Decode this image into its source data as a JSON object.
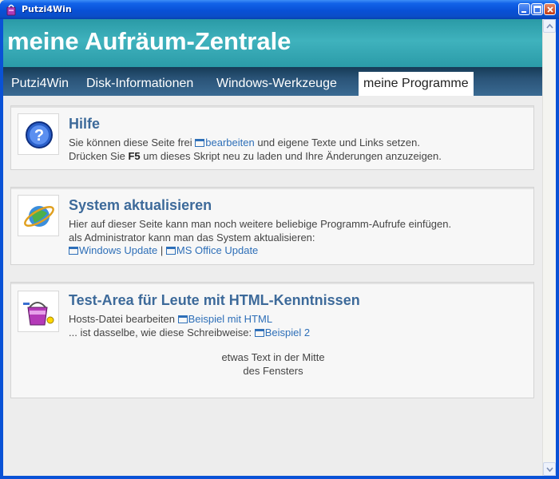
{
  "window": {
    "title": "Putzi4Win"
  },
  "header": {
    "title": "meine Aufräum-Zentrale"
  },
  "nav": {
    "tabs": [
      {
        "label": "Putzi4Win"
      },
      {
        "label": "Disk-Informationen"
      },
      {
        "label": "Windows-Werkzeuge"
      },
      {
        "label": "meine Programme"
      }
    ]
  },
  "panels": {
    "help": {
      "title": "Hilfe",
      "line1_pre": "Sie können diese Seite frei",
      "line1_link": "bearbeiten",
      "line1_post": "und eigene Texte und Links setzen.",
      "line2_pre": "Drücken Sie",
      "line2_key": "F5",
      "line2_post": "um dieses Skript neu zu laden und Ihre Änderungen anzuzeigen."
    },
    "update": {
      "title": "System aktualisieren",
      "line1": "Hier auf dieser Seite kann man noch weitere beliebige Programm-Aufrufe einfügen.",
      "line2": "als Administrator kann man das System aktualisieren:",
      "link1": "Windows Update",
      "separator": "|",
      "link2": "MS Office Update"
    },
    "test": {
      "title": "Test-Area für Leute mit HTML-Kenntnissen",
      "line1_pre": "Hosts-Datei bearbeiten",
      "line1_link": "Beispiel mit HTML",
      "line2_pre": "... ist dasselbe, wie diese Schreibweise:",
      "line2_link": "Beispiel 2",
      "center1": "etwas Text in der Mitte",
      "center2": "des Fensters"
    }
  }
}
